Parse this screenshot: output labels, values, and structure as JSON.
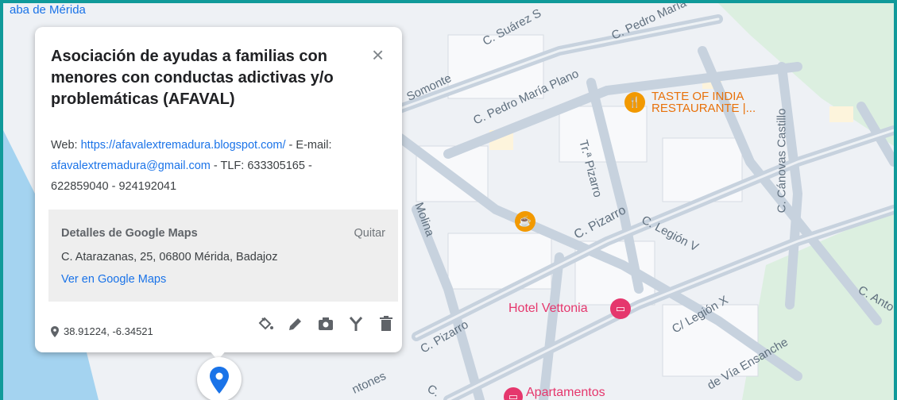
{
  "map": {
    "street_labels": [
      "aba de Mérida",
      "C. Suárez S",
      "C. Pedro María",
      "Somonte",
      "C. Pedro María Plano",
      "Tr.ª Pizarro",
      "C. Cánovas Castillo",
      "C. Pizarro",
      "C. Legión V",
      "Molina",
      "C/ Legión X",
      "C. Pizarro",
      "de Vía Ensanche",
      "C. Anto",
      "ntones",
      "C."
    ],
    "pois": {
      "restaurant": "TASTE OF INDIA RESTAURANTE |...",
      "hotel": "Hotel Vettonia",
      "apartments": "Apartamentos"
    },
    "colors": {
      "water": "#a4d3f0",
      "frame": "#109a9a",
      "marker": "#1a73e8",
      "park": "#dcefe0"
    }
  },
  "card": {
    "title": "Asociación de ayudas a familias con menores con conductas adictivas y/o problemáticas (AFAVAL)",
    "close_icon": "close-icon",
    "description": {
      "web_label": "Web: ",
      "web_url": "https://afavalextremadura.blogspot.com/",
      "after_web": " - E-mail: ",
      "email": "afavalextremadura@gmail.com",
      "after_email": " - TLF: 633305165 - 622859040 - 924192041"
    },
    "gmaps": {
      "title": "Detalles de Google Maps",
      "remove": "Quitar",
      "address": "C. Atarazanas, 25, 06800 Mérida, Badajoz",
      "link": "Ver en Google Maps"
    },
    "coords": "38.91224, -6.34521",
    "tools": [
      "paint-bucket-icon",
      "pencil-icon",
      "camera-icon",
      "route-icon",
      "trash-icon"
    ]
  }
}
